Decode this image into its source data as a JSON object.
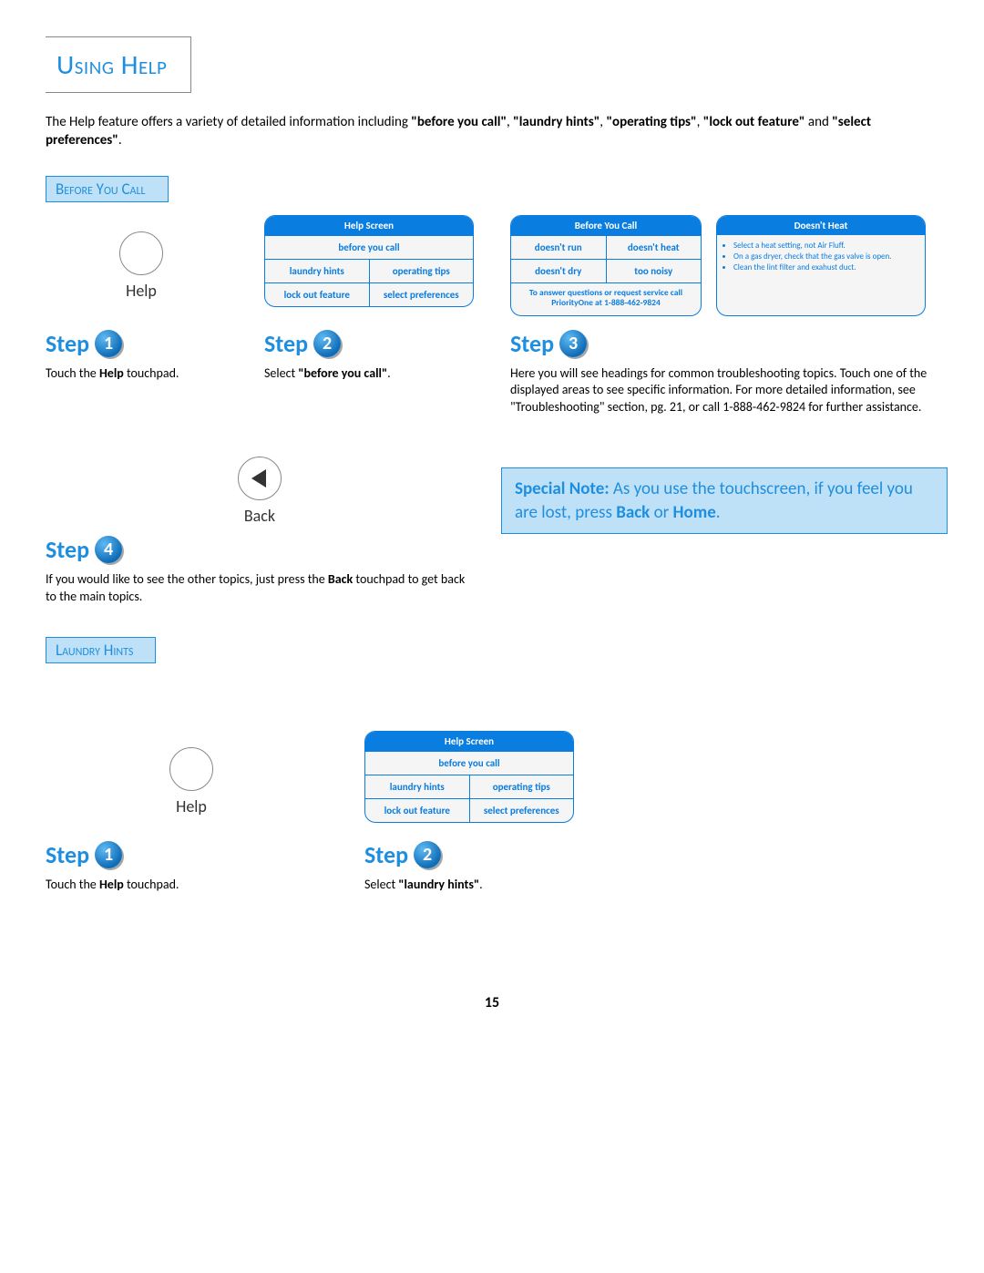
{
  "title": "Using Help",
  "intro": {
    "lead": "The Help feature offers a variety of detailed information including ",
    "q1": "\"before you call\"",
    "sep1": ", ",
    "q2": "\"laundry hints\"",
    "sep2": ", ",
    "q3": "\"operating tips\"",
    "sep3": ", ",
    "q4": "\"lock out feature\"",
    "sep4": " and ",
    "q5": "\"select preferences\"",
    "tail": "."
  },
  "sections": {
    "beforeYouCall": "Before You Call",
    "laundryHints": "Laundry Hints"
  },
  "touchpads": {
    "help": "Help",
    "back": "Back"
  },
  "stepWord": "Step",
  "steps": {
    "s1": "1",
    "s2": "2",
    "s3": "3",
    "s4": "4"
  },
  "byc": {
    "s1a": "Touch the ",
    "s1b": "Help",
    "s1c": " touchpad.",
    "s2a": "Select ",
    "s2b": "\"before you call\"",
    "s2c": ".",
    "s3": "Here you will see headings for common troubleshooting topics.  Touch one of the displayed areas to see specific information.  For more detailed information, see \"Troubleshooting\" section,  pg. 21, or call 1-888-462-9824 for further assistance.",
    "s4a": "If you would like to see the other topics, just press the ",
    "s4b": "Back",
    "s4c": " touchpad to get back to the main topics."
  },
  "note": {
    "p1": "Special Note:",
    "p2": "  As you use the touchscreen, if you feel you are lost, press ",
    "p3": "Back",
    "p4": " or ",
    "p5": "Home",
    "p6": "."
  },
  "lh": {
    "s1a": "Touch the ",
    "s1b": "Help",
    "s1c": " touchpad.",
    "s2a": "Select ",
    "s2b": "\"laundry hints\"",
    "s2c": "."
  },
  "screens": {
    "helpScreen": {
      "title": "Help Screen",
      "r1": "before you call",
      "r2a": "laundry hints",
      "r2b": "operating tips",
      "r3a": "lock out feature",
      "r3b": "select preferences"
    },
    "beforeYouCall": {
      "title": "Before You Call",
      "r1a": "doesn't run",
      "r1b": "doesn't heat",
      "r2a": "doesn't dry",
      "r2b": "too noisy",
      "foot": "To answer questions or request service call PriorityOne at 1-888-462-9824"
    },
    "doesntHeat": {
      "title": "Doesn't Heat",
      "b1": "Select a heat setting, not Air Fluff.",
      "b2": "On a gas dryer, check that the gas valve is open.",
      "b3": "Clean the lint filter and exahust duct."
    }
  },
  "pageNumber": "15"
}
